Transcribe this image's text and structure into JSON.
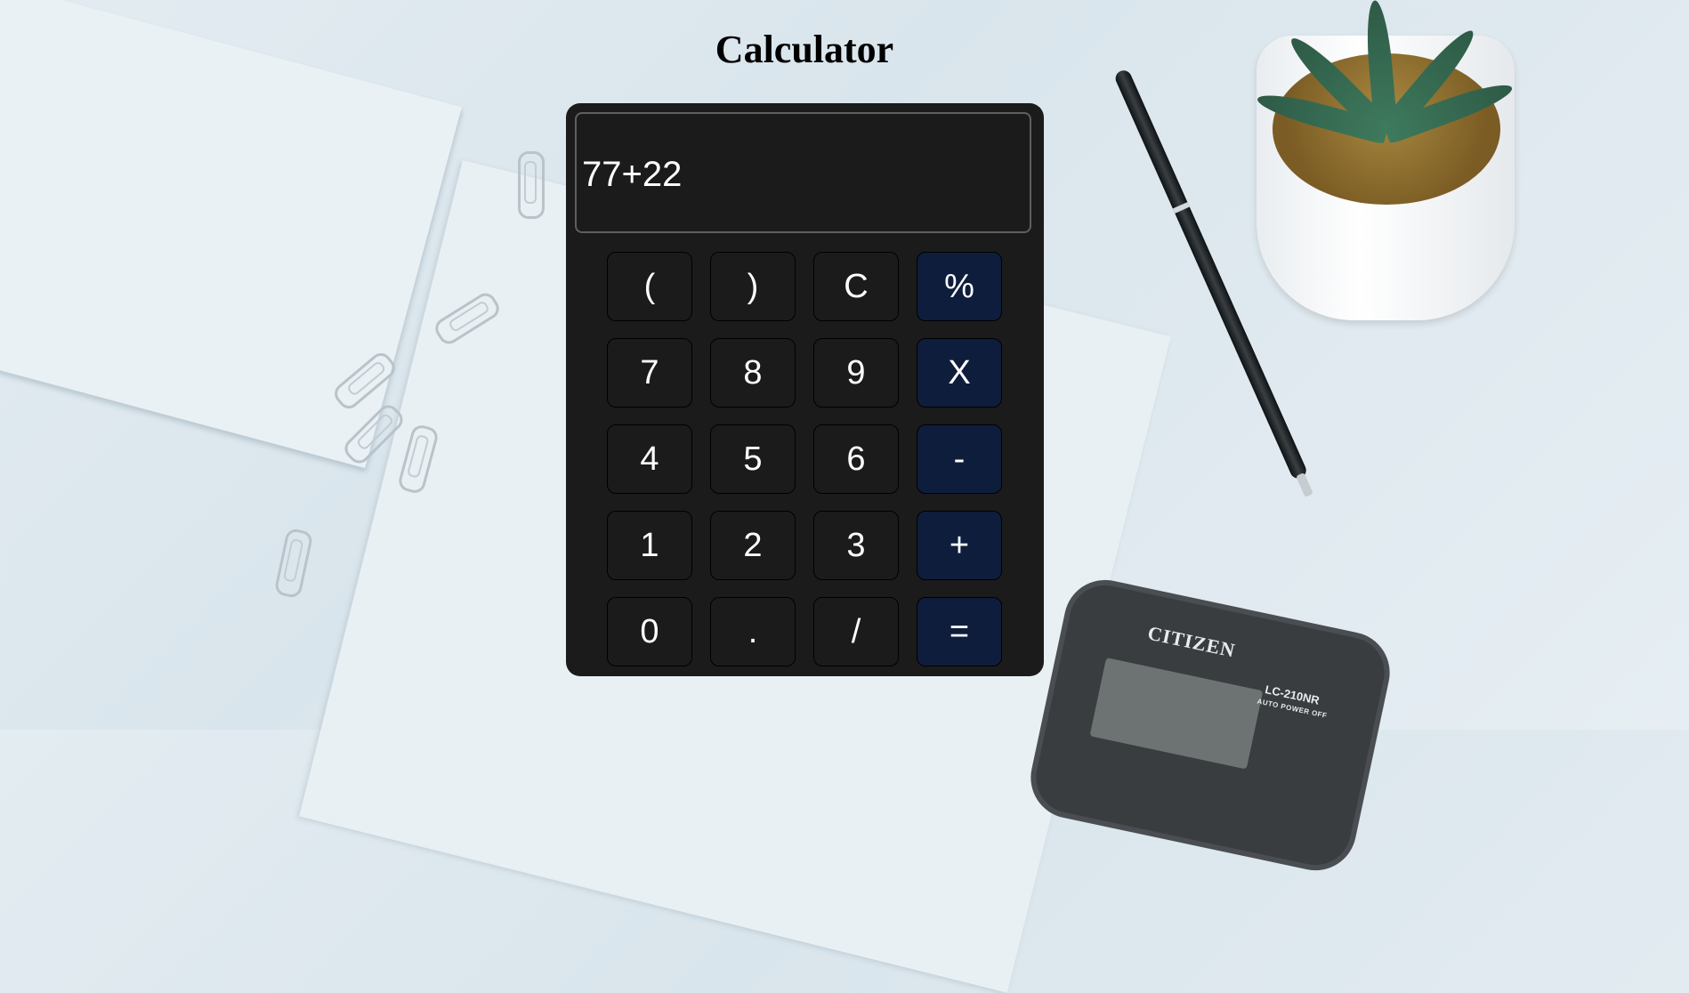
{
  "app": {
    "title": "Calculator",
    "display_value": "77+22"
  },
  "keypad": {
    "rows": [
      [
        {
          "label": "(",
          "type": "digit",
          "name": "open-paren-key"
        },
        {
          "label": ")",
          "type": "digit",
          "name": "close-paren-key"
        },
        {
          "label": "C",
          "type": "digit",
          "name": "clear-key"
        },
        {
          "label": "%",
          "type": "op",
          "name": "percent-key"
        }
      ],
      [
        {
          "label": "7",
          "type": "digit",
          "name": "digit-7-key"
        },
        {
          "label": "8",
          "type": "digit",
          "name": "digit-8-key"
        },
        {
          "label": "9",
          "type": "digit",
          "name": "digit-9-key"
        },
        {
          "label": "X",
          "type": "op",
          "name": "multiply-key"
        }
      ],
      [
        {
          "label": "4",
          "type": "digit",
          "name": "digit-4-key"
        },
        {
          "label": "5",
          "type": "digit",
          "name": "digit-5-key"
        },
        {
          "label": "6",
          "type": "digit",
          "name": "digit-6-key"
        },
        {
          "label": "-",
          "type": "op",
          "name": "subtract-key"
        }
      ],
      [
        {
          "label": "1",
          "type": "digit",
          "name": "digit-1-key"
        },
        {
          "label": "2",
          "type": "digit",
          "name": "digit-2-key"
        },
        {
          "label": "3",
          "type": "digit",
          "name": "digit-3-key"
        },
        {
          "label": "+",
          "type": "op",
          "name": "add-key"
        }
      ],
      [
        {
          "label": "0",
          "type": "digit",
          "name": "digit-0-key"
        },
        {
          "label": ".",
          "type": "digit",
          "name": "decimal-key"
        },
        {
          "label": "/",
          "type": "digit",
          "name": "divide-key"
        },
        {
          "label": "=",
          "type": "op",
          "name": "equals-key"
        }
      ]
    ]
  },
  "colors": {
    "calculator_body": "#1c1b1b",
    "operator_key": "#0f1d3d",
    "key_text": "#ffffff"
  },
  "background_photo": {
    "calculator_brand": "CITIZEN",
    "calculator_model": "LC-210NR",
    "calculator_subtext": "AUTO POWER OFF"
  }
}
